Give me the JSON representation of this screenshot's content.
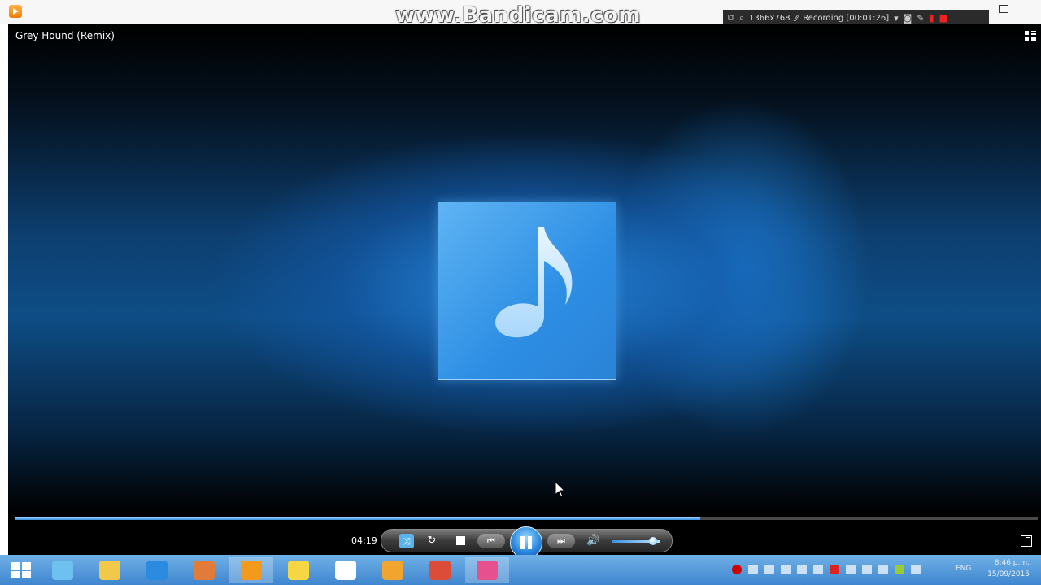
{
  "window": {
    "watermark": "www.Bandicam.com"
  },
  "recorder": {
    "resolution": "1366x768",
    "status": "Recording [00:01:26]"
  },
  "player": {
    "track_title": "Grey Hound (Remix)",
    "elapsed": "04:19",
    "progress_fraction": 0.67,
    "volume_fraction": 0.85,
    "state": "playing"
  },
  "taskbar": {
    "apps": [
      {
        "name": "file-explorer-icon",
        "color": "#6ec1ef"
      },
      {
        "name": "folder-icon",
        "color": "#f2c84b"
      },
      {
        "name": "internet-explorer-icon",
        "color": "#2b8be0"
      },
      {
        "name": "media-tool-icon",
        "color": "#e07b39"
      },
      {
        "name": "media-player-icon",
        "color": "#f39a1d",
        "active": true
      },
      {
        "name": "sun-app-icon",
        "color": "#f6d743"
      },
      {
        "name": "document-icon",
        "color": "#ffffff"
      },
      {
        "name": "fl-studio-icon",
        "color": "#f2a52e"
      },
      {
        "name": "chrome-icon",
        "color": "#dd4b39"
      },
      {
        "name": "itunes-icon",
        "color": "#e6508f",
        "active": true
      }
    ],
    "language": "ENG",
    "time": "8:46 p.m.",
    "date": "15/09/2015"
  }
}
